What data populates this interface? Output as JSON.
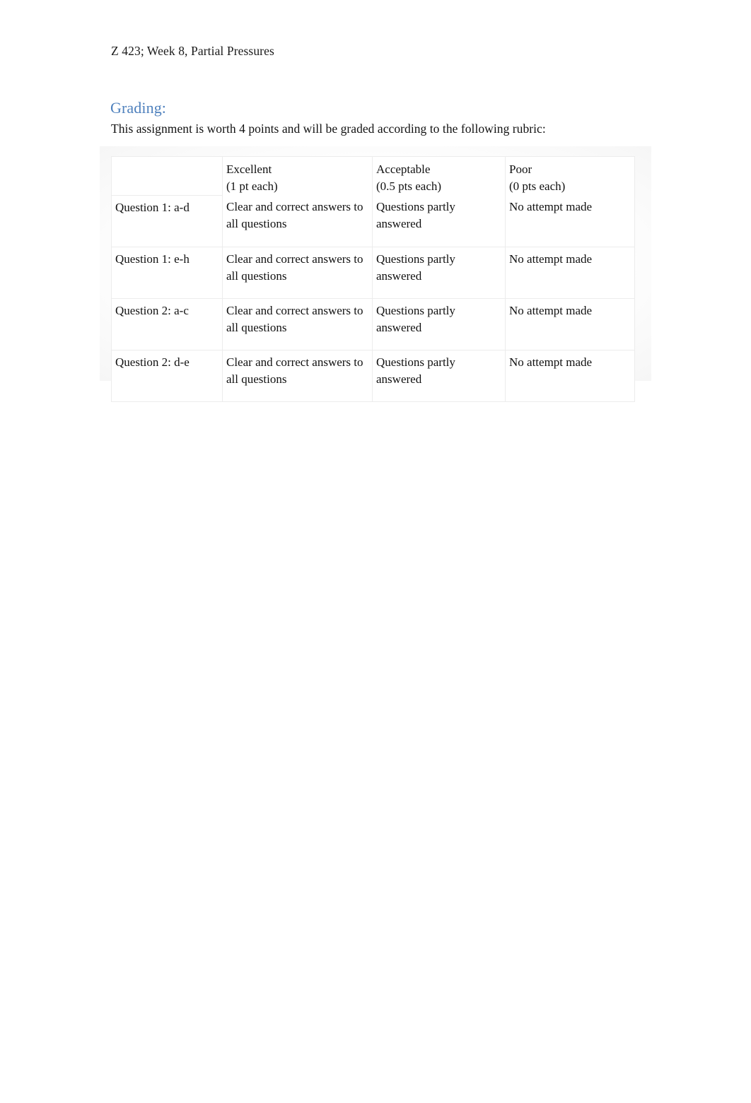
{
  "document": {
    "header_line": "Z 423; Week 8, Partial Pressures",
    "section_heading": "Grading:",
    "intro_paragraph": "This assignment is worth 4 points and will be graded according to the following rubric:",
    "heading_color": "#4F81BD",
    "body_color": "#000000",
    "page_background": "#FFFFFF"
  },
  "rubric_table": {
    "columns": [
      {
        "title": "",
        "points": ""
      },
      {
        "title": "Excellent",
        "points": "(1 pt each)"
      },
      {
        "title": "Acceptable",
        "points": "(0.5 pts each)"
      },
      {
        "title": "Poor",
        "points": "(0 pts each)"
      }
    ],
    "rows": [
      {
        "criteria": "Question 1: a-d",
        "excellent": "Clear and correct answers to all questions",
        "acceptable": "Questions partly answered",
        "poor": "No attempt made"
      },
      {
        "criteria": "Question 1: e-h",
        "excellent": "Clear and correct answers to all questions",
        "acceptable": "Questions partly answered",
        "poor": "No attempt made"
      },
      {
        "criteria": "Question 2: a-c",
        "excellent": "Clear and correct answers to all questions",
        "acceptable": "Questions partly answered",
        "poor": "No attempt made"
      },
      {
        "criteria": "Question 2: d-e",
        "excellent": "Clear and correct answers to all questions",
        "acceptable": "Questions partly answered",
        "poor": "No attempt made"
      }
    ]
  }
}
